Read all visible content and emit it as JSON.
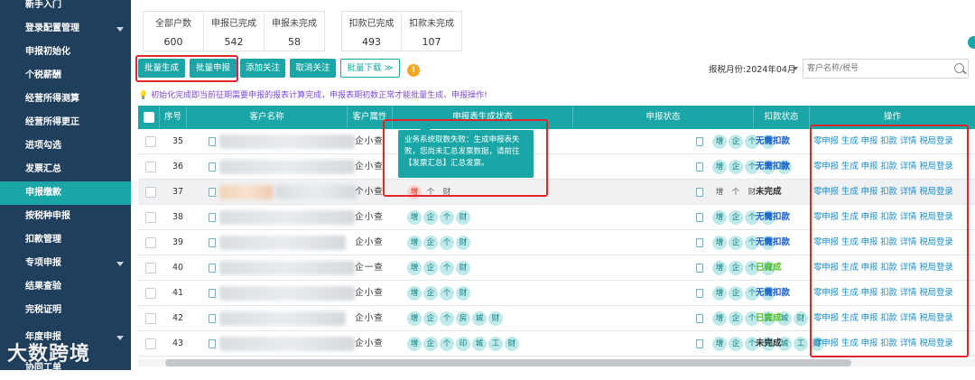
{
  "sidebar": {
    "items": [
      {
        "label": "新手入门",
        "caret": false,
        "active": false
      },
      {
        "label": "登录配置管理",
        "caret": true,
        "active": false
      },
      {
        "label": "申报初始化",
        "caret": false,
        "active": false
      },
      {
        "label": "个税薪酬",
        "caret": false,
        "active": false
      },
      {
        "label": "经营所得测算",
        "caret": false,
        "active": false
      },
      {
        "label": "经营所得更正",
        "caret": false,
        "active": false
      },
      {
        "label": "进项勾选",
        "caret": false,
        "active": false
      },
      {
        "label": "发票汇总",
        "caret": false,
        "active": false
      },
      {
        "label": "申报缴款",
        "caret": false,
        "active": true
      },
      {
        "label": "按税种申报",
        "caret": false,
        "active": false
      },
      {
        "label": "扣款管理",
        "caret": false,
        "active": false
      },
      {
        "label": "专项申报",
        "caret": true,
        "active": false
      },
      {
        "label": "结果查验",
        "caret": false,
        "active": false
      },
      {
        "label": "完税证明",
        "caret": false,
        "active": false
      },
      {
        "label": "年度申报",
        "caret": true,
        "active": false
      },
      {
        "label": "协同工单",
        "caret": false,
        "active": false
      }
    ]
  },
  "stats": {
    "group1": [
      {
        "label": "全部户数",
        "value": "600"
      },
      {
        "label": "申报已完成",
        "value": "542"
      },
      {
        "label": "申报未完成",
        "value": "58"
      }
    ],
    "group2": [
      {
        "label": "扣款已完成",
        "value": "493"
      },
      {
        "label": "扣款未完成",
        "value": "107"
      }
    ]
  },
  "toolbar": {
    "batch_generate": "批量生成",
    "batch_declare": "批量申报",
    "add_follow": "添加关注",
    "cancel_follow": "取消关注",
    "batch_download": "批量下载 ≫",
    "info_icon": "!",
    "month_label": "报税月份:2024年04月",
    "search_placeholder": "客户名称/税号"
  },
  "notice": "初始化完成即当前征期需要申报的报表计算完成，申报表期初数正常才能批量生成、申报操作!",
  "table": {
    "headers": [
      "序号",
      "客户名称",
      "客户属性",
      "申报表生成状态",
      "申报状态",
      "扣款状态",
      "操作"
    ],
    "rows": [
      {
        "seq": "35",
        "attr": "企小查",
        "badges": [],
        "decl": [
          "增",
          "企",
          "个",
          "财"
        ],
        "deduct": "无需扣款",
        "deduct_color": "#1a5fd1"
      },
      {
        "seq": "36",
        "attr": "企小查",
        "badges": [],
        "decl": [
          "增",
          "企",
          "个",
          "工",
          "财"
        ],
        "deduct": "无需扣款",
        "deduct_color": "#1a5fd1"
      },
      {
        "seq": "37",
        "attr": "个小查",
        "badges": [
          "增",
          "个",
          "财"
        ],
        "decl": [
          "增",
          "个",
          "财"
        ],
        "deduct": "未完成",
        "deduct_color": "#333333"
      },
      {
        "seq": "38",
        "attr": "企小查",
        "badges": [
          "增",
          "企",
          "个",
          "财"
        ],
        "decl": [
          "增",
          "企",
          "个",
          "财"
        ],
        "deduct": "无需扣款",
        "deduct_color": "#1a5fd1"
      },
      {
        "seq": "39",
        "attr": "企小查",
        "badges": [
          "增",
          "企",
          "个",
          "财"
        ],
        "decl": [
          "增",
          "企",
          "个",
          "财"
        ],
        "deduct": "无需扣款",
        "deduct_color": "#1a5fd1"
      },
      {
        "seq": "40",
        "attr": "企一查",
        "badges": [
          "增",
          "企",
          "个",
          "财"
        ],
        "decl": [
          "增",
          "企",
          "个",
          "财"
        ],
        "deduct": "已完成",
        "deduct_color": "#52c41a"
      },
      {
        "seq": "41",
        "attr": "企小查",
        "badges": [
          "增",
          "企",
          "个",
          "财"
        ],
        "decl": [
          "增",
          "企",
          "个",
          "财"
        ],
        "deduct": "无需扣款",
        "deduct_color": "#1a5fd1"
      },
      {
        "seq": "42",
        "attr": "企小查",
        "badges": [
          "增",
          "企",
          "个",
          "房",
          "城",
          "财"
        ],
        "decl": [
          "增",
          "企",
          "个",
          "房",
          "城",
          "财"
        ],
        "deduct": "已完成",
        "deduct_color": "#52c41a"
      },
      {
        "seq": "43",
        "attr": "企小查",
        "badges": [
          "增",
          "企",
          "个",
          "印",
          "城",
          "工",
          "财"
        ],
        "decl": [
          "增",
          "企",
          "个",
          "印",
          "城",
          "工",
          "财"
        ],
        "deduct": "未完成",
        "deduct_color": "#333333"
      }
    ],
    "ops": [
      "零申报",
      "生成",
      "申报",
      "扣款",
      "详情",
      "税局登录"
    ]
  },
  "tooltip": "业务系统取数失败：生成申报表失败，您尚未汇总发票数据，请前往【发票汇总】汇总发票。",
  "watermark": "大数跨境",
  "colors": {
    "teal": "#1aa6a6",
    "sidebar": "#1f3f5c",
    "highlight": "#e0262b",
    "link": "#1a8fd1"
  }
}
